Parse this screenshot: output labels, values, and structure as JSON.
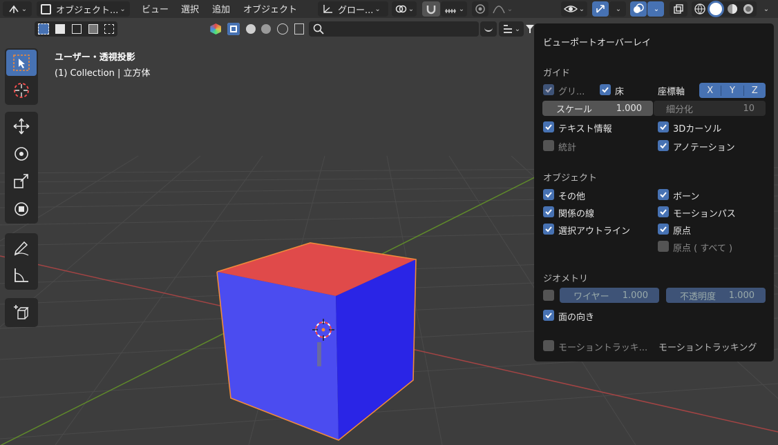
{
  "header": {
    "mode_label": "オブジェクト...",
    "menus": [
      "ビュー",
      "選択",
      "追加",
      "オブジェクト"
    ],
    "transform_orientation": "グロー..."
  },
  "viewport": {
    "view_name": "ユーザー・透視投影",
    "collection_info": "(1) Collection | 立方体"
  },
  "overlay_panel": {
    "title": "ビューポートオーバーレイ",
    "guides": {
      "section": "ガイド",
      "grid_label": "グリ...",
      "floor_label": "床",
      "axes_label": "座標軸",
      "axis_x": "X",
      "axis_y": "Y",
      "axis_z": "Z",
      "scale_label": "スケール",
      "scale_value": "1.000",
      "subdivision_label": "細分化",
      "subdivision_value": "10",
      "text_info_label": "テキスト情報",
      "cursor3d_label": "3Dカーソル",
      "stats_label": "統計",
      "annotations_label": "アノテーション"
    },
    "objects": {
      "section": "オブジェクト",
      "extras_label": "その他",
      "bones_label": "ボーン",
      "relationship_lines_label": "関係の線",
      "motion_paths_label": "モーションパス",
      "outline_selected_label": "選択アウトライン",
      "origins_label": "原点",
      "origins_all_label": "原点 ( すべて )"
    },
    "geometry": {
      "section": "ジオメトリ",
      "wireframe_label": "ワイヤー",
      "wireframe_value": "1.000",
      "opacity_label": "不透明度",
      "opacity_value": "1.000",
      "face_orientation_label": "面の向き"
    },
    "motion_tracking": {
      "checkbox_label": "モーショントラッキ...",
      "label": "モーショントラッキング"
    }
  },
  "colors": {
    "accent": "#4772b3",
    "panel_bg": "#181818",
    "viewport_bg": "#3d3d3d",
    "cube_top": "#e04a4a",
    "cube_front": "#4b4cf0",
    "cube_side": "#2a25e6"
  }
}
